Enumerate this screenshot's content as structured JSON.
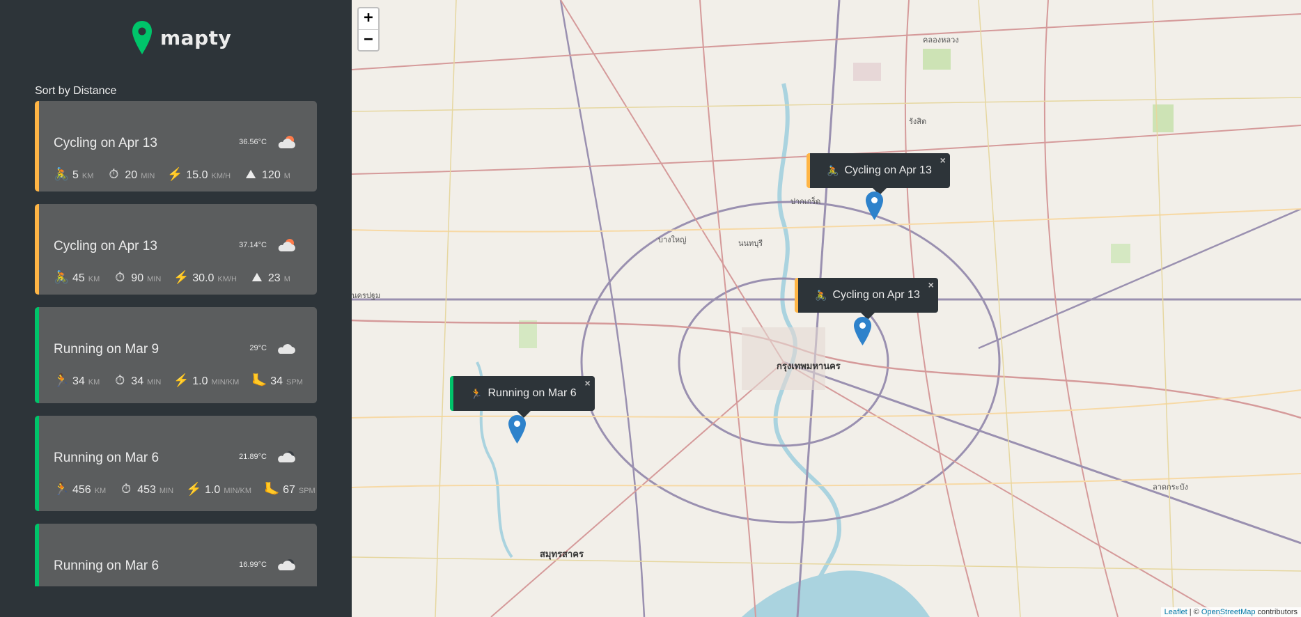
{
  "app": {
    "name": "mapty"
  },
  "sort": {
    "label": "Sort by Distance"
  },
  "workouts": [
    {
      "type": "cycling",
      "title": "Cycling on Apr 13",
      "temp": "36.56°C",
      "details": [
        {
          "icon": "🚴",
          "value": "5",
          "unit": "km"
        },
        {
          "icon": "⏱",
          "value": "20",
          "unit": "min"
        },
        {
          "icon": "⚡️",
          "value": "15.0",
          "unit": "km/h"
        },
        {
          "icon": "⛰",
          "value": "120",
          "unit": "m"
        }
      ]
    },
    {
      "type": "cycling",
      "title": "Cycling on Apr 13",
      "temp": "37.14°C",
      "details": [
        {
          "icon": "🚴",
          "value": "45",
          "unit": "km"
        },
        {
          "icon": "⏱",
          "value": "90",
          "unit": "min"
        },
        {
          "icon": "⚡️",
          "value": "30.0",
          "unit": "km/h"
        },
        {
          "icon": "⛰",
          "value": "23",
          "unit": "m"
        }
      ]
    },
    {
      "type": "running",
      "title": "Running on Mar 9",
      "temp": "29°C",
      "details": [
        {
          "icon": "🏃",
          "value": "34",
          "unit": "km"
        },
        {
          "icon": "⏱",
          "value": "34",
          "unit": "min"
        },
        {
          "icon": "⚡️",
          "value": "1.0",
          "unit": "min/km"
        },
        {
          "icon": "🦶",
          "value": "34",
          "unit": "spm"
        }
      ]
    },
    {
      "type": "running",
      "title": "Running on Mar 6",
      "temp": "21.89°C",
      "details": [
        {
          "icon": "🏃",
          "value": "456",
          "unit": "km"
        },
        {
          "icon": "⏱",
          "value": "453",
          "unit": "min"
        },
        {
          "icon": "⚡️",
          "value": "1.0",
          "unit": "min/km"
        },
        {
          "icon": "🦶",
          "value": "67",
          "unit": "spm"
        }
      ]
    },
    {
      "type": "running",
      "title": "Running on Mar 6",
      "temp": "16.99°C",
      "details": []
    }
  ],
  "map": {
    "zoom_in": "+",
    "zoom_out": "−",
    "popups": [
      {
        "type": "cycling",
        "icon": "🚴",
        "label": "Cycling on Apr 13",
        "close": "×"
      },
      {
        "type": "cycling",
        "icon": "🚴",
        "label": "Cycling on Apr 13",
        "close": "×"
      },
      {
        "type": "running",
        "icon": "🏃",
        "label": "Running on Mar 6",
        "close": "×"
      }
    ],
    "labels": [
      "ปากเกร็ด",
      "กรุงเทพมหานคร",
      "สมุทรสาคร",
      "รังสิต",
      "คลองหลวง",
      "นครปฐม",
      "บางใหญ่",
      "นนทบุรี",
      "ลาดกระบัง"
    ],
    "attribution": {
      "leaflet": "Leaflet",
      "sep": " | © ",
      "osm": "OpenStreetMap",
      "suffix": " contributors"
    }
  },
  "colors": {
    "cycling": "#ffb545",
    "running": "#00c46a",
    "dark": "#2d3439",
    "card": "#5b5d5e"
  }
}
